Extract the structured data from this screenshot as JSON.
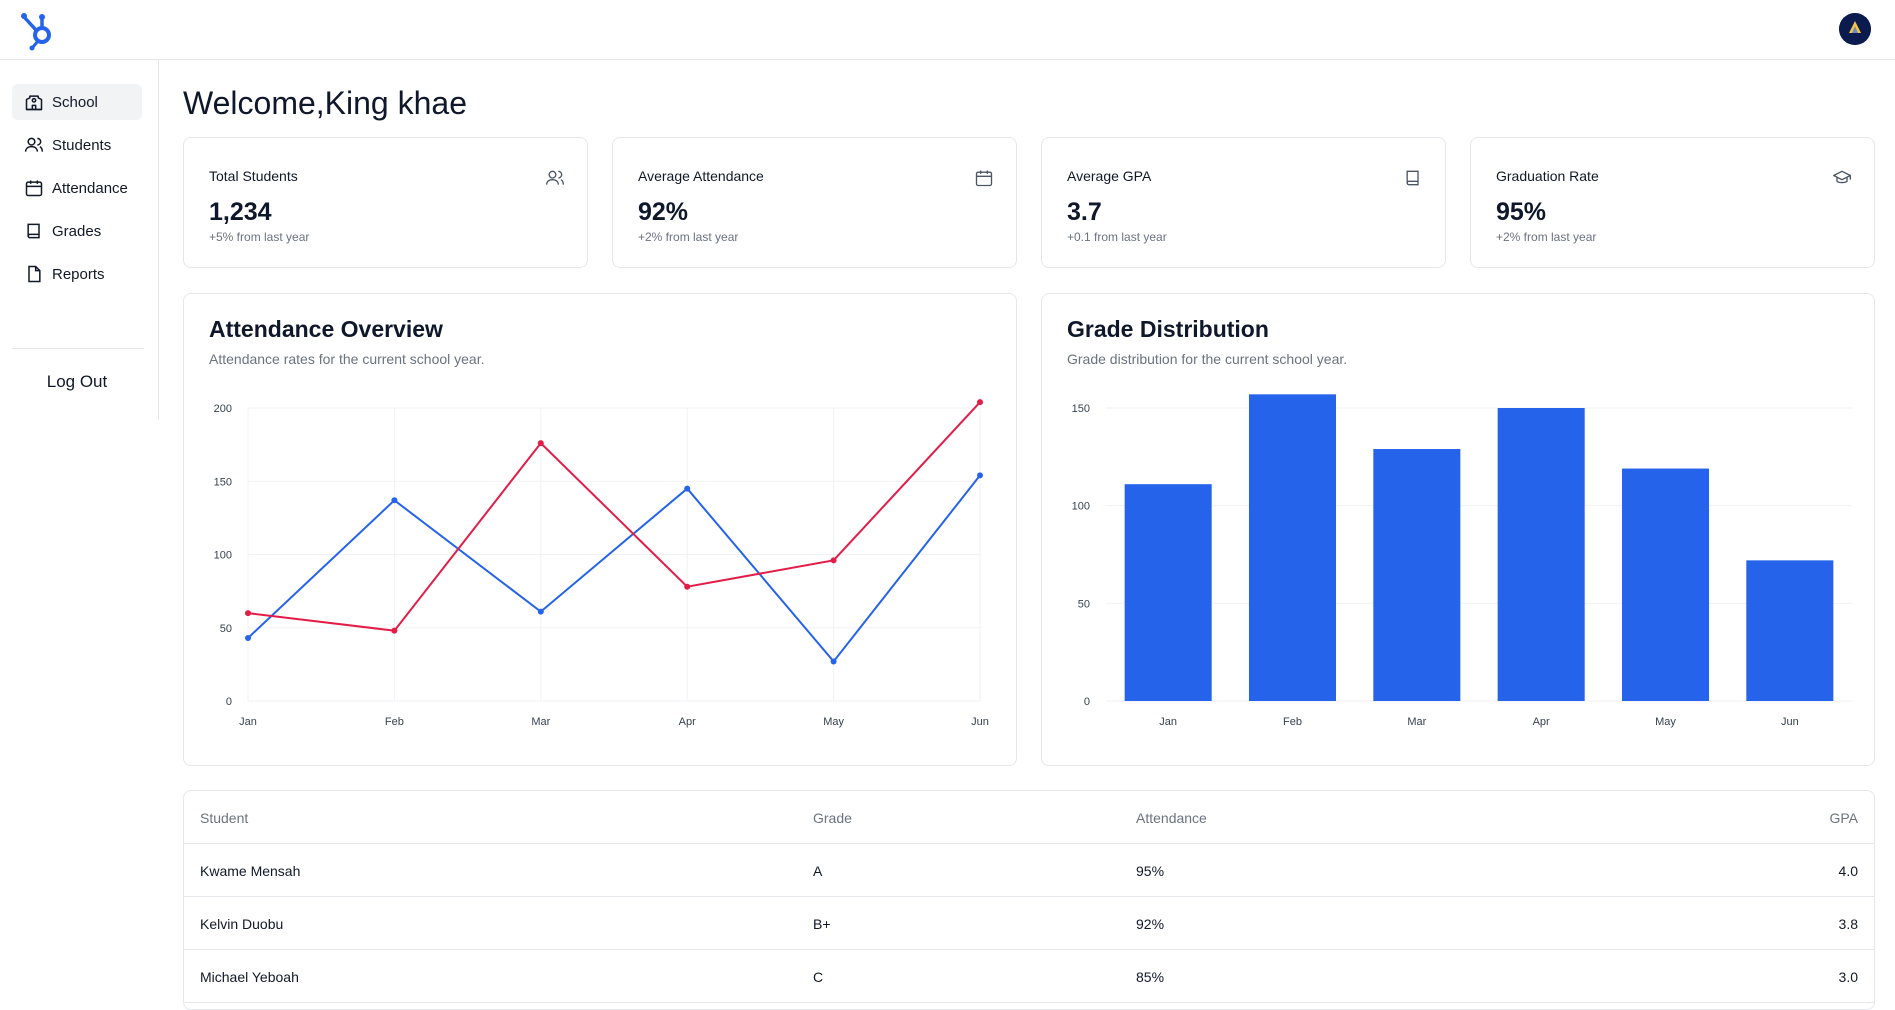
{
  "header": {
    "logo_icon": "hubspot-sprocket-icon",
    "avatar_icon": "user-avatar-icon"
  },
  "sidebar": {
    "items": [
      {
        "label": "School",
        "icon": "school-icon",
        "active": true
      },
      {
        "label": "Students",
        "icon": "users-icon",
        "active": false
      },
      {
        "label": "Attendance",
        "icon": "calendar-icon",
        "active": false
      },
      {
        "label": "Grades",
        "icon": "book-icon",
        "active": false
      },
      {
        "label": "Reports",
        "icon": "file-icon",
        "active": false
      }
    ],
    "logout_label": "Log Out"
  },
  "welcome": "Welcome,King khae",
  "stats": [
    {
      "title": "Total Students",
      "value": "1,234",
      "note": "+5% from last year",
      "icon": "users-icon"
    },
    {
      "title": "Average Attendance",
      "value": "92%",
      "note": "+2% from last year",
      "icon": "calendar-icon"
    },
    {
      "title": "Average GPA",
      "value": "3.7",
      "note": "+0.1 from last year",
      "icon": "book-icon"
    },
    {
      "title": "Graduation Rate",
      "value": "95%",
      "note": "+2% from last year",
      "icon": "graduation-cap-icon"
    }
  ],
  "chart_data": [
    {
      "type": "line",
      "title": "Attendance Overview",
      "subtitle": "Attendance rates for the current school year.",
      "categories": [
        "Jan",
        "Feb",
        "Mar",
        "Apr",
        "May",
        "Jun"
      ],
      "series": [
        {
          "color": "#2563eb",
          "values": [
            43,
            137,
            61,
            145,
            27,
            154
          ]
        },
        {
          "color": "#e11d48",
          "values": [
            60,
            48,
            176,
            78,
            96,
            204
          ]
        }
      ],
      "ylim": [
        0,
        200
      ],
      "yticks": [
        0,
        50,
        100,
        150,
        200
      ],
      "grid": true
    },
    {
      "type": "bar",
      "title": "Grade Distribution",
      "subtitle": "Grade distribution for the current school year.",
      "categories": [
        "Jan",
        "Feb",
        "Mar",
        "Apr",
        "May",
        "Jun"
      ],
      "values": [
        111,
        157,
        129,
        150,
        119,
        72
      ],
      "color": "#2563eb",
      "ylim": [
        0,
        150
      ],
      "yticks": [
        0,
        50,
        100,
        150
      ],
      "grid": true
    }
  ],
  "table": {
    "headers": [
      "Student",
      "Grade",
      "Attendance",
      "GPA"
    ],
    "rows": [
      [
        "Kwame Mensah",
        "A",
        "95%",
        "4.0"
      ],
      [
        "Kelvin Duobu",
        "B+",
        "92%",
        "3.8"
      ],
      [
        "Michael Yeboah",
        "C",
        "85%",
        "3.0"
      ]
    ]
  }
}
